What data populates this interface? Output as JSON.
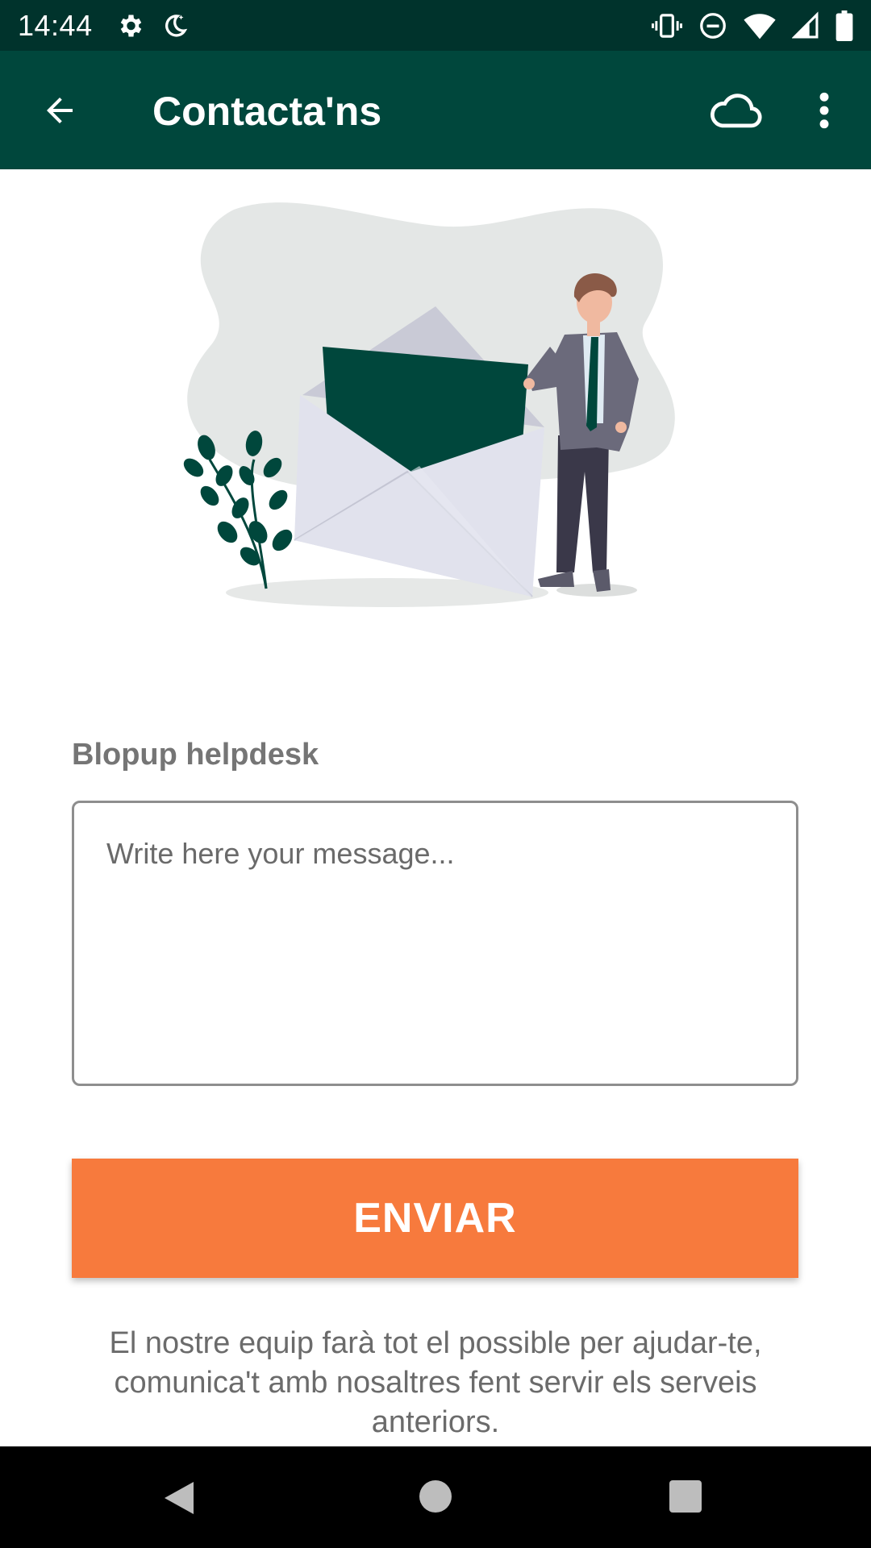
{
  "status_bar": {
    "time": "14:44",
    "left_icons": [
      "gear-icon",
      "night-mode-icon"
    ],
    "right_icons": [
      "vibrate-icon",
      "do-not-disturb-icon",
      "wifi-icon",
      "signal-icon",
      "battery-icon"
    ]
  },
  "app_bar": {
    "title": "Contacta'ns",
    "back_icon": "arrow-back-icon",
    "actions": [
      "cloud-icon",
      "more-vert-icon"
    ]
  },
  "form": {
    "label": "Blopup helpdesk",
    "message_placeholder": "Write here your message...",
    "message_value": "",
    "send_label": "ENVIAR"
  },
  "info_text": "El nostre equip farà tot el possible per ajudar-te, comunica't amb nosaltres fent servir els serveis anteriors.",
  "colors": {
    "status_bar": "#00332c",
    "app_bar": "#00473c",
    "send_button": "#f77a3d",
    "label": "#757575"
  },
  "nav_bar": [
    "nav-back-icon",
    "nav-home-icon",
    "nav-recents-icon"
  ]
}
